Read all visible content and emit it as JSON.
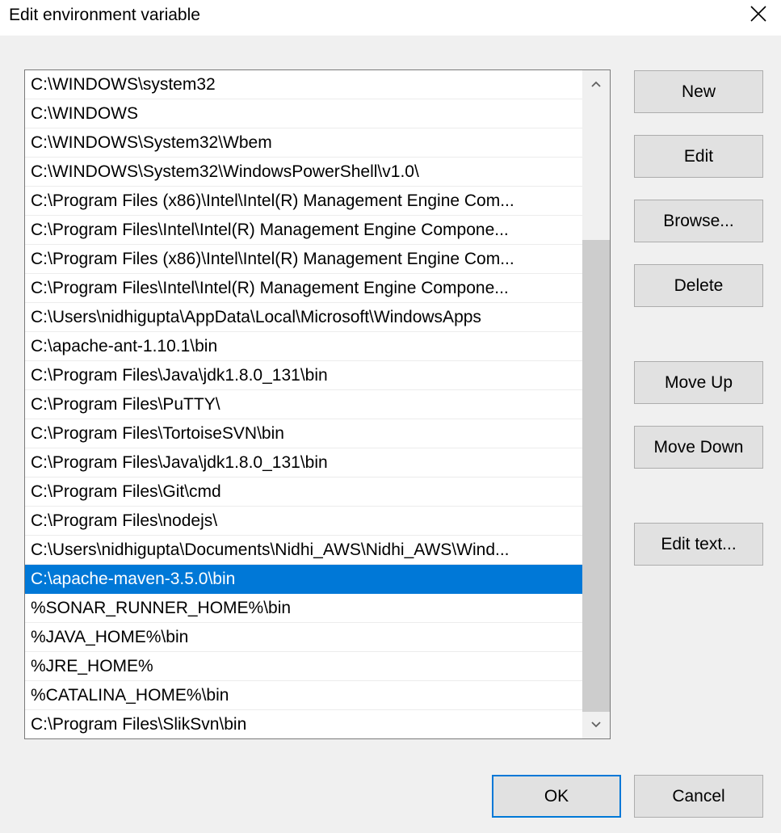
{
  "window": {
    "title": "Edit environment variable"
  },
  "list": {
    "items": [
      "C:\\WINDOWS\\system32",
      "C:\\WINDOWS",
      "C:\\WINDOWS\\System32\\Wbem",
      "C:\\WINDOWS\\System32\\WindowsPowerShell\\v1.0\\",
      "C:\\Program Files (x86)\\Intel\\Intel(R) Management Engine Com...",
      "C:\\Program Files\\Intel\\Intel(R) Management Engine Compone...",
      "C:\\Program Files (x86)\\Intel\\Intel(R) Management Engine Com...",
      "C:\\Program Files\\Intel\\Intel(R) Management Engine Compone...",
      "C:\\Users\\nidhigupta\\AppData\\Local\\Microsoft\\WindowsApps",
      "C:\\apache-ant-1.10.1\\bin",
      "C:\\Program Files\\Java\\jdk1.8.0_131\\bin",
      "C:\\Program Files\\PuTTY\\",
      "C:\\Program Files\\TortoiseSVN\\bin",
      "C:\\Program Files\\Java\\jdk1.8.0_131\\bin",
      "C:\\Program Files\\Git\\cmd",
      "C:\\Program Files\\nodejs\\",
      "C:\\Users\\nidhigupta\\Documents\\Nidhi_AWS\\Nidhi_AWS\\Wind...",
      "C:\\apache-maven-3.5.0\\bin",
      "%SONAR_RUNNER_HOME%\\bin",
      "%JAVA_HOME%\\bin",
      "%JRE_HOME%",
      "%CATALINA_HOME%\\bin",
      "C:\\Program Files\\SlikSvn\\bin"
    ],
    "selected_index": 17
  },
  "buttons": {
    "new": "New",
    "edit": "Edit",
    "browse": "Browse...",
    "delete": "Delete",
    "move_up": "Move Up",
    "move_down": "Move Down",
    "edit_text": "Edit text...",
    "ok": "OK",
    "cancel": "Cancel"
  },
  "colors": {
    "selection": "#0078d7",
    "default_button_border": "#0078d7"
  },
  "icons": {
    "close": "close-icon",
    "scroll_up": "chevron-up-icon",
    "scroll_down": "chevron-down-icon"
  }
}
